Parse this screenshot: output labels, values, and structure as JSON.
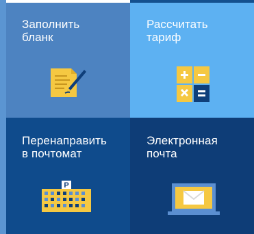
{
  "tiles": [
    {
      "id": "form",
      "label": "Заполнить\nбланк",
      "icon": "document-pen-icon",
      "color": "#4d83c1"
    },
    {
      "id": "tariff",
      "label": "Рассчитать\nтариф",
      "icon": "calculator-icon",
      "color": "#5db1f2"
    },
    {
      "id": "redirect",
      "label": "Перенаправить\nв почтомат",
      "icon": "parcel-locker-icon",
      "color": "#0f4b8c"
    },
    {
      "id": "email",
      "label": "Электронная\nпочта",
      "icon": "laptop-mail-icon",
      "color": "#0e3d77"
    }
  ],
  "locker_badge": "P",
  "colors": {
    "accent_yellow": "#f5c842",
    "white": "#ffffff"
  }
}
